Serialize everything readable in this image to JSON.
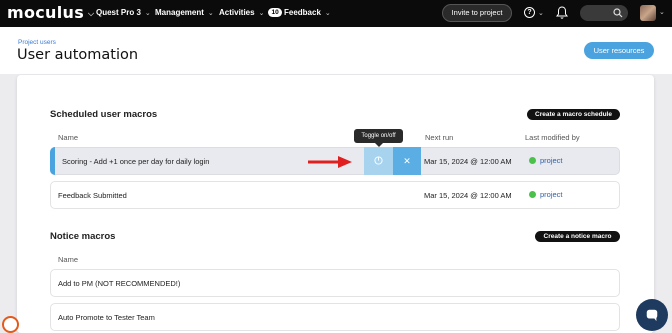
{
  "nav": {
    "logo": "moculus",
    "items": [
      {
        "label": "Quest Pro 3"
      },
      {
        "label": "Management"
      },
      {
        "label": "Activities",
        "badge": "10"
      },
      {
        "label": "Feedback"
      }
    ],
    "invite_label": "Invite to project"
  },
  "header": {
    "breadcrumb": "Project users",
    "title": "User automation",
    "resources_label": "User resources"
  },
  "scheduled": {
    "title": "Scheduled user macros",
    "create_label": "Create a macro schedule",
    "columns": {
      "name": "Name",
      "next_run": "Next run",
      "last_modified": "Last modified by"
    },
    "tooltip": "Toggle on/off",
    "rows": [
      {
        "name": "Scoring - Add +1 once per day for daily login",
        "next_run": "Mar 15, 2024 @ 12:00 AM",
        "modified_by": "project"
      },
      {
        "name": "Feedback Submitted",
        "next_run": "Mar 15, 2024 @ 12:00 AM",
        "modified_by": "project"
      }
    ]
  },
  "notice": {
    "title": "Notice macros",
    "create_label": "Create a notice macro",
    "columns": {
      "name": "Name"
    },
    "rows": [
      {
        "name": "Add to PM (NOT RECOMMENDED!)"
      },
      {
        "name": "Auto Promote to Tester Team"
      }
    ]
  },
  "colors": {
    "accent": "#4aa3df",
    "status_ok": "#4cc04c",
    "arrow": "#e02020"
  }
}
